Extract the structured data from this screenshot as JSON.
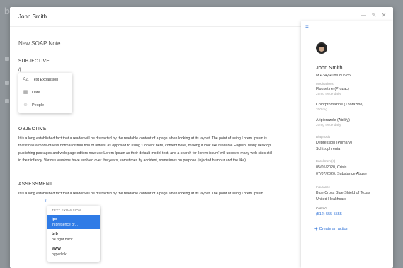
{
  "background": {
    "logo": "b"
  },
  "modal": {
    "title": "John Smith",
    "header_icons": [
      "minimize-icon",
      "edit-icon",
      "close-icon"
    ],
    "minimize_glyph": "—",
    "edit_glyph": "✎",
    "close_glyph": "✕"
  },
  "editor": {
    "note_title": "New SOAP Note",
    "caret": "/|",
    "sections": {
      "subjective": "SUBJECTIVE",
      "objective": "OBJECTIVE",
      "assessment": "ASSESSMENT"
    },
    "objective_text": "It is a long established fact that a reader will be distracted by the readable content of a page when looking at its layout. The point of using Lorem Ipsum is that it has a more-or-less normal distribution of letters, as opposed to using 'Content here, content here', making it look like readable English. Many desktop publishing packages and web page editors now use Lorem Ipsum as their default model text, and a search for 'lorem ipsum' will uncover many web sites still in their infancy. Various versions have evolved over the years, sometimes by accident, sometimes on purpose (injected humour and the like).",
    "assessment_text": "It is a long established fact that a reader will be distracted by the readable content of a page when looking at its layout. The point of using Lorem Ipsum",
    "assessment_trigger": "/|",
    "insert_menu": [
      {
        "label": "Text Expansion",
        "icon": "text-expansion-icon",
        "glyph": "Aa"
      },
      {
        "label": "Date",
        "icon": "calendar-icon",
        "glyph": "▦"
      },
      {
        "label": "People",
        "icon": "person-icon",
        "glyph": "☺"
      }
    ],
    "text_expansion": {
      "header": "TEXT EXPANSION",
      "items": [
        {
          "key": "ipo",
          "value": "in presence of...",
          "active": true
        },
        {
          "key": "brb",
          "value": "be right back...",
          "active": false
        },
        {
          "key": "www",
          "value": "hyperlink",
          "active": false
        }
      ]
    }
  },
  "patient": {
    "collapse_glyph": "≡",
    "name": "John Smith",
    "meta": "M • 34y • 08/08/1985",
    "medications_label": "Medications",
    "medications": [
      {
        "name": "Fluoxetine (Prozac)",
        "dose": "25mg twice daily"
      },
      {
        "name": "Chlorpromazine (Thorazine)",
        "dose": "200 mg..."
      },
      {
        "name": "Aripiprazole (Abilify)",
        "dose": "20mg twice daily"
      }
    ],
    "diagnosis_label": "Diagnosis",
    "diagnosis": [
      "Depression (Primary)",
      "Schizophrenia"
    ],
    "enrollments_label": "Enrollment(s)",
    "enrollments": [
      "05/05/2020, Crisis",
      "07/07/2020, Substance Abuse"
    ],
    "insurance_label": "Insurance",
    "insurance": [
      "Blue Cross Blue Shield of Texas",
      "United Healthcare"
    ],
    "contact_label": "Contact",
    "phone": "(512) 555-5555",
    "create_action": "Create an action"
  },
  "colors": {
    "accent": "#2f7be6",
    "link": "#2b6fd6"
  }
}
